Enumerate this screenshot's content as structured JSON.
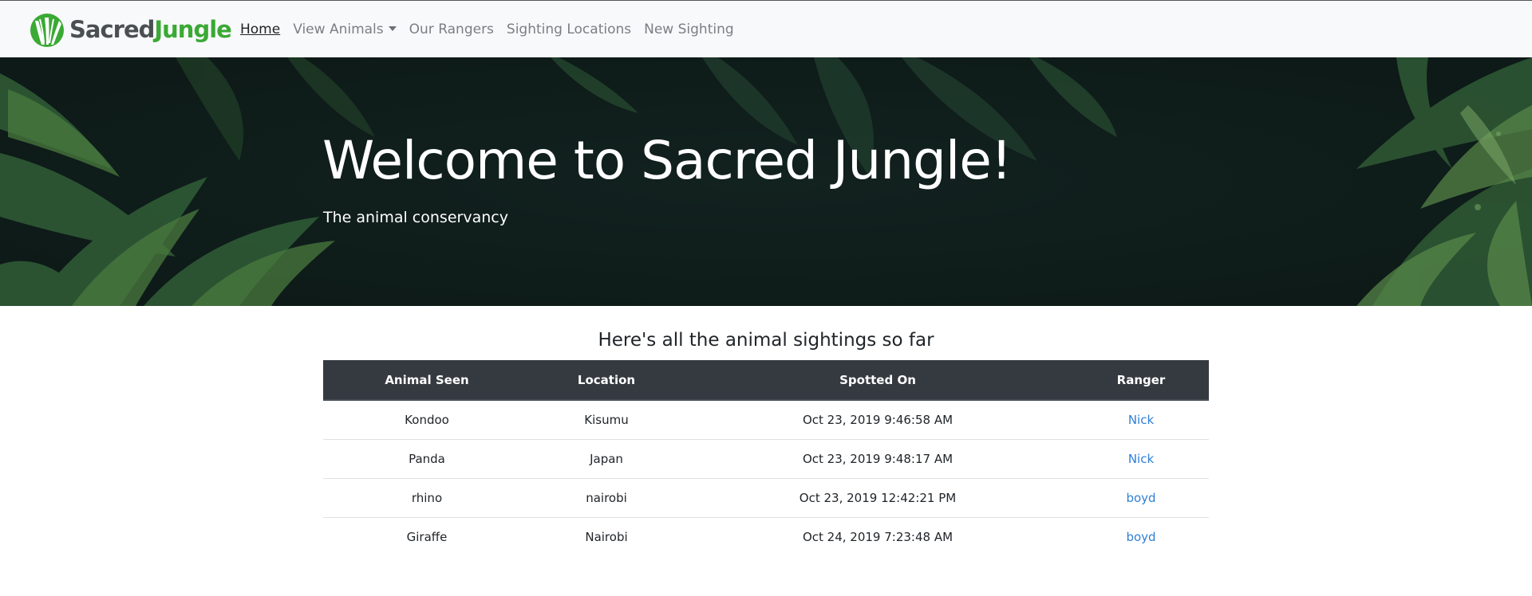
{
  "navbar": {
    "brand": {
      "part1": "Sacred",
      "part2": "Jungle"
    },
    "links": [
      {
        "label": "Home",
        "active": true
      },
      {
        "label": "View Animals",
        "dropdown": true
      },
      {
        "label": "Our Rangers"
      },
      {
        "label": "Sighting Locations"
      },
      {
        "label": "New Sighting"
      }
    ]
  },
  "hero": {
    "title": "Welcome to Sacred Jungle!",
    "subtitle": "The animal conservancy"
  },
  "sightings": {
    "heading": "Here's all the animal sightings so far",
    "columns": [
      "Animal Seen",
      "Location",
      "Spotted On",
      "Ranger"
    ],
    "rows": [
      {
        "animal": "Kondoo",
        "location": "Kisumu",
        "spotted_on": "Oct 23, 2019 9:46:58 AM",
        "ranger": "Nick"
      },
      {
        "animal": "Panda",
        "location": "Japan",
        "spotted_on": "Oct 23, 2019 9:48:17 AM",
        "ranger": "Nick"
      },
      {
        "animal": "rhino",
        "location": "nairobi",
        "spotted_on": "Oct 23, 2019 12:42:21 PM",
        "ranger": "boyd"
      },
      {
        "animal": "Giraffe",
        "location": "Nairobi",
        "spotted_on": "Oct 24, 2019 7:23:48 AM",
        "ranger": "boyd"
      }
    ]
  },
  "colors": {
    "brand_green": "#3aa935",
    "brand_gray": "#4a4f52",
    "table_header_bg": "#343a40",
    "link": "#2f7fd6",
    "hero_bg": "#0f1f1c"
  }
}
